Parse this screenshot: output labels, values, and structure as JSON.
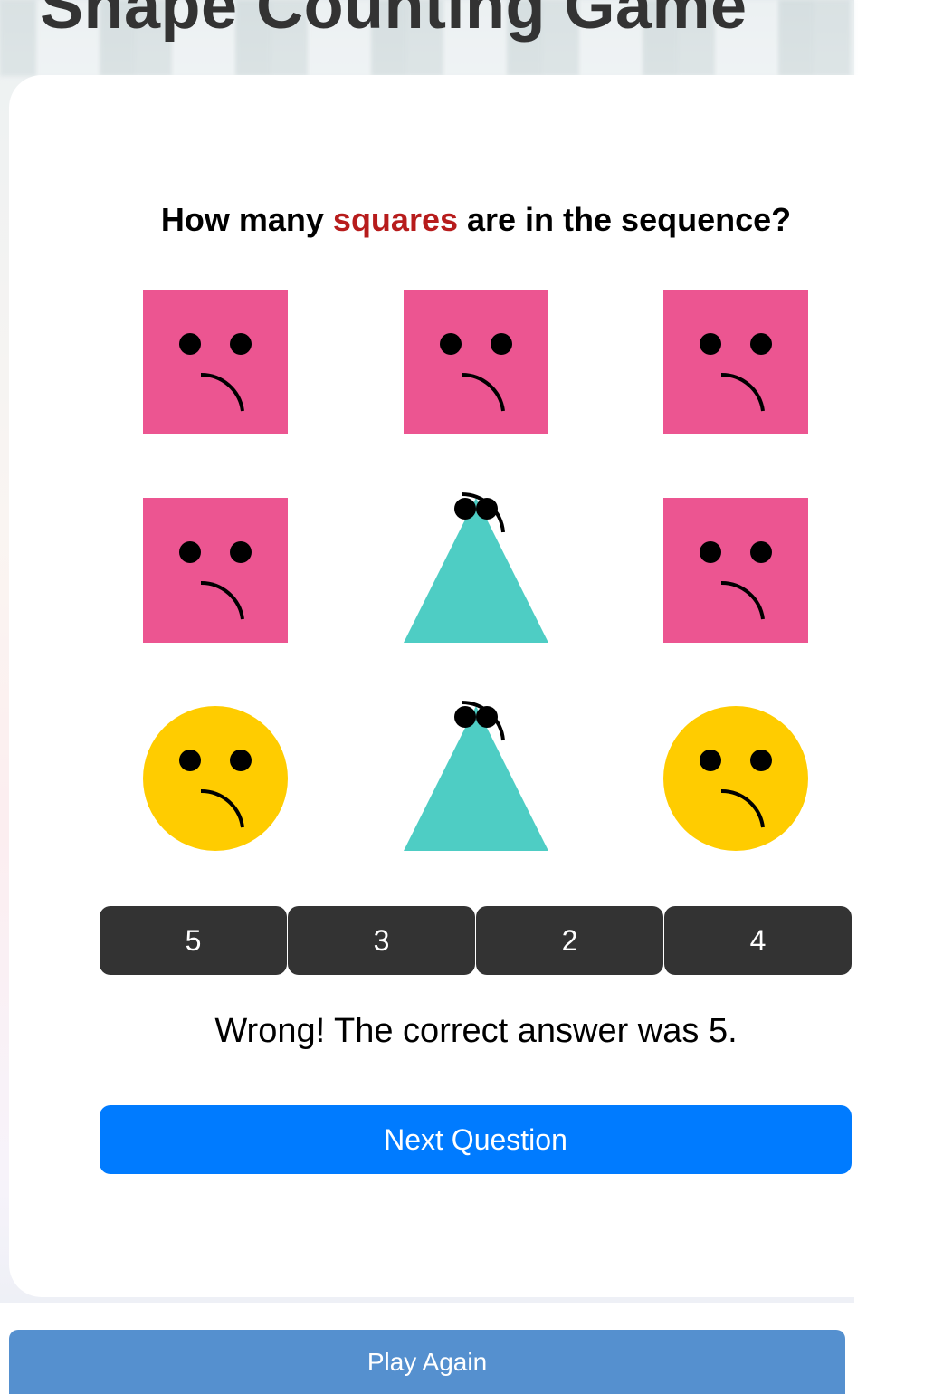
{
  "game": {
    "title": "Shape Counting Game",
    "question_prefix": "How many ",
    "question_highlight": "squares",
    "question_suffix": " are in the sequence?",
    "grid": [
      {
        "shape": "square",
        "color": "#ec5591",
        "face": "sad"
      },
      {
        "shape": "square",
        "color": "#ec5591",
        "face": "sad"
      },
      {
        "shape": "square",
        "color": "#ec5591",
        "face": "sad"
      },
      {
        "shape": "square",
        "color": "#ec5591",
        "face": "sad"
      },
      {
        "shape": "triangle",
        "color": "#4ecdc4",
        "face": "sad"
      },
      {
        "shape": "square",
        "color": "#ec5591",
        "face": "sad"
      },
      {
        "shape": "circle",
        "color": "#ffcc00",
        "face": "sad"
      },
      {
        "shape": "triangle",
        "color": "#4ecdc4",
        "face": "sad"
      },
      {
        "shape": "circle",
        "color": "#ffcc00",
        "face": "sad"
      }
    ],
    "answers": [
      "5",
      "3",
      "2",
      "4"
    ],
    "feedback": "Wrong! The correct answer was 5.",
    "next_label": "Next Question",
    "play_again_label": "Play Again",
    "colors": {
      "highlight": "#b71c1c",
      "answer_bg": "#333333",
      "next_bg": "#007bff",
      "play_again_bg": "#5590cf"
    }
  }
}
